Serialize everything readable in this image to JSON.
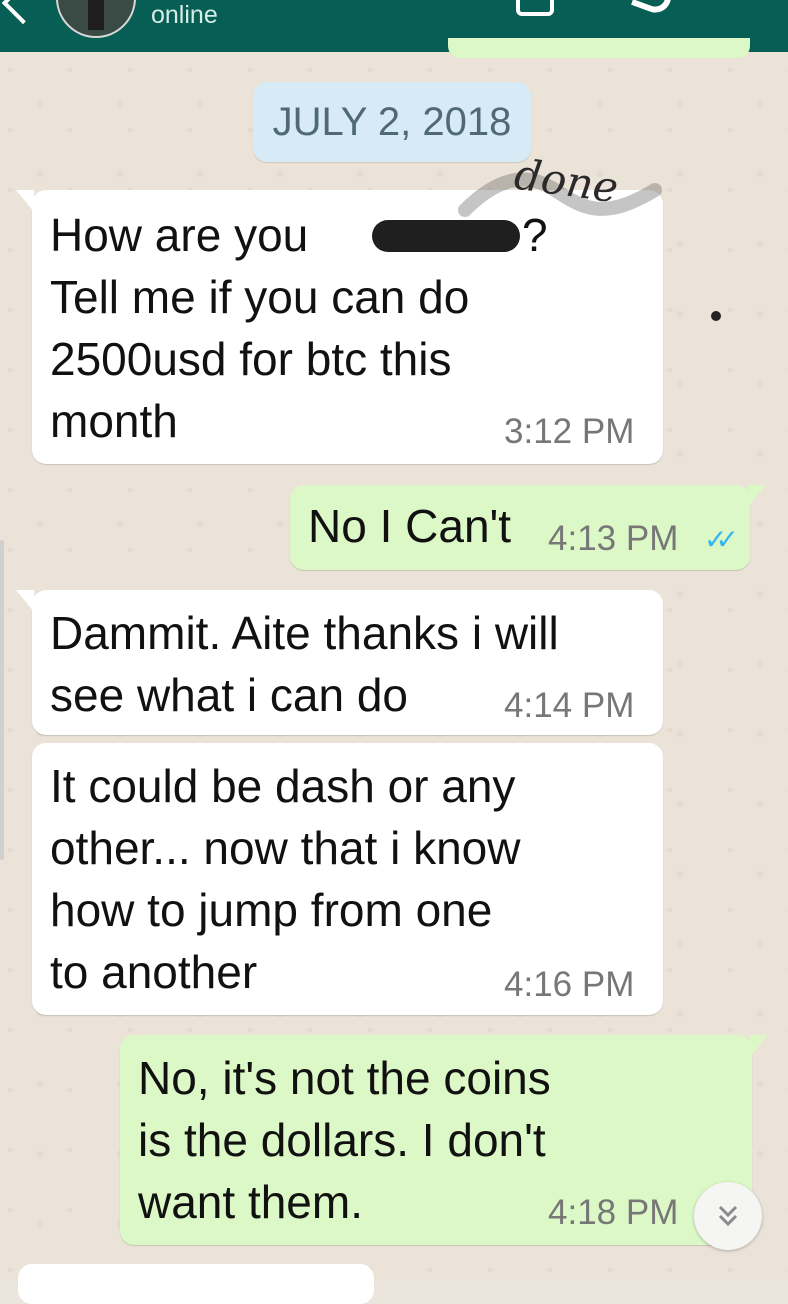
{
  "header": {
    "status": "online"
  },
  "date_chip": "JULY 2, 2018",
  "overlay_scribble": "done",
  "messages": [
    {
      "direction": "in",
      "lines": [
        "How are you",
        "Tell me if you can do",
        "2500usd for btc this",
        "month"
      ],
      "trailing_punct": "?",
      "time": "3:12 PM",
      "redacted": true
    },
    {
      "direction": "out",
      "lines": [
        "No I Can't"
      ],
      "time": "4:13 PM",
      "read_ticks": "✓✓"
    },
    {
      "direction": "in",
      "lines": [
        "Dammit. Aite thanks i will",
        "see what i can do"
      ],
      "time": "4:14 PM"
    },
    {
      "direction": "in",
      "lines": [
        "It could be dash or any",
        "other... now that i know",
        "how to jump from one",
        "to another"
      ],
      "time": "4:16 PM"
    },
    {
      "direction": "out",
      "lines": [
        "No, it's not the coins",
        "is the dollars. I don't",
        "want them."
      ],
      "time": "4:18 PM"
    }
  ],
  "scroll_down_icon": "chevron-double-down-icon",
  "colors": {
    "header": "#075e54",
    "incoming": "#ffffff",
    "outgoing": "#dcf8c6",
    "date_chip": "#d6ebf5",
    "read_tick": "#34b7f1"
  }
}
